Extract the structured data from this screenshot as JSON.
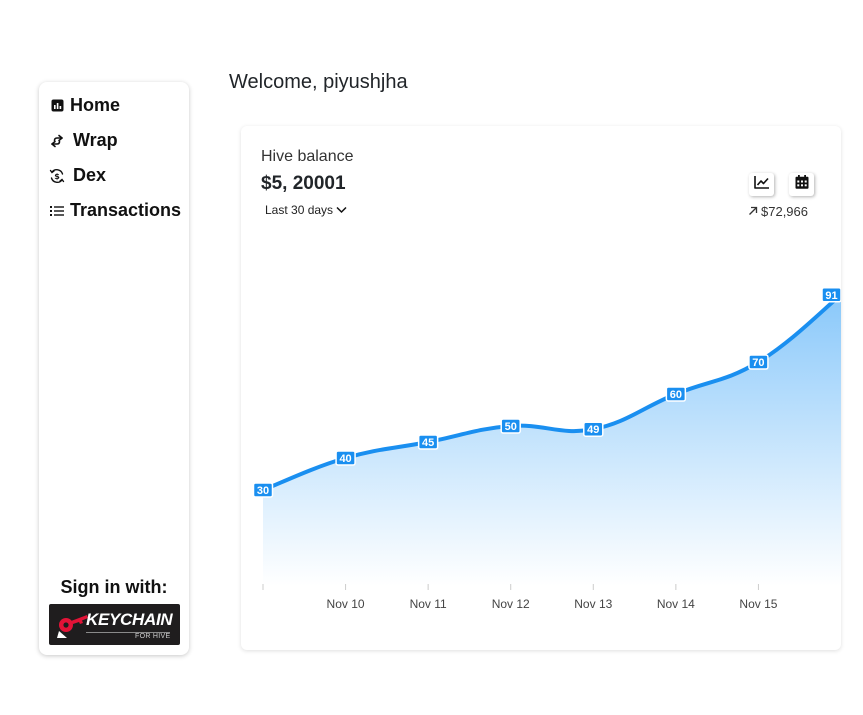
{
  "sidebar": {
    "items": [
      {
        "label": "Home",
        "icon": "bar-chart-icon"
      },
      {
        "label": "Wrap",
        "icon": "swap-arrows-icon"
      },
      {
        "label": "Dex",
        "icon": "currency-exchange-icon"
      },
      {
        "label": "Transactions",
        "icon": "list-icon"
      }
    ],
    "sign_in_label": "Sign in with:",
    "keychain": {
      "brand": "KEYCHAIN",
      "subtitle": "FOR HIVE",
      "accent": "#e31337"
    }
  },
  "header": {
    "welcome": "Welcome, piyushjha"
  },
  "card": {
    "title": "Hive balance",
    "value": "$5, 20001",
    "range_label": "Last 30 days",
    "change_value": "$72,966",
    "buttons": [
      "line-chart-icon",
      "calendar-icon"
    ]
  },
  "colors": {
    "line": "#1a8ff0",
    "area_top": "#89c8fa",
    "label_bg": "#1a8ff0"
  },
  "chart_data": {
    "type": "area",
    "x": [
      "",
      "Nov 10",
      "Nov 11",
      "Nov 12",
      "Nov 13",
      "Nov 14",
      "Nov 15",
      ""
    ],
    "series": [
      {
        "values": [
          30,
          40,
          45,
          50,
          49,
          60,
          70,
          91
        ]
      }
    ],
    "ylim": [
      0,
      105
    ],
    "grid": false
  }
}
